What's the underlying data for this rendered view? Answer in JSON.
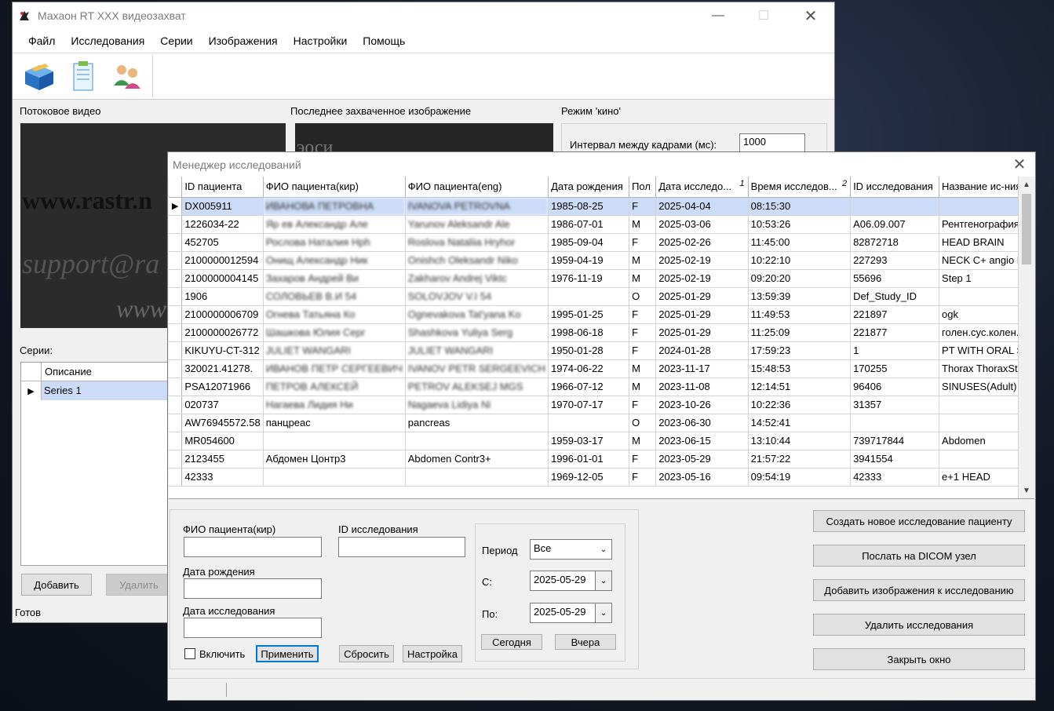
{
  "main_window": {
    "title": "Махаон RT XXX видеозахват",
    "menu": [
      "Файл",
      "Исследования",
      "Серии",
      "Изображения",
      "Настройки",
      "Помощь"
    ],
    "labels": {
      "stream_video": "Потоковое видео",
      "last_captured": "Последнее захваченное изображение",
      "cine_mode": "Режим 'кино'",
      "frame_interval": "Интервал между кадрами (мс):",
      "series": "Серии:"
    },
    "frame_interval_value": "1000",
    "video_watermark": [
      "www.rastr.n",
      "support@ra",
      "www"
    ],
    "last_image_text": "эоси",
    "series_table": {
      "header": "Описание",
      "rows": [
        "Series 1"
      ]
    },
    "buttons": {
      "add": "Добавить",
      "delete": "Удалить"
    },
    "status": "Готов"
  },
  "dialog": {
    "title": "Менеджер исследований",
    "columns": [
      "ID пациента",
      "ФИО пациента(кир)",
      "ФИО пациента(eng)",
      "Дата рождения",
      "Пол",
      "Дата исследо...",
      "Время исследов...",
      "ID исследования",
      "Название ис-ния"
    ],
    "sort_marks": {
      "date": "1",
      "time": "2"
    },
    "rows": [
      [
        "DX005911",
        "ИВАНОВА ПЕТРОВНА",
        "IVANOVA PETROVNA",
        "1985-08-25",
        "F",
        "2025-04-04",
        "08:15:30",
        "",
        ""
      ],
      [
        "1226034-22",
        "Яр  ев Александр Але",
        "Yarunov Aleksandr Ale",
        "1986-07-01",
        "M",
        "2025-03-06",
        "10:53:26",
        "A06.09.007",
        "Рентгенография л"
      ],
      [
        "452705",
        "Рослова Наталия Hph",
        "Roslova Nataliia Hryhor",
        "1985-09-04",
        "F",
        "2025-02-26",
        "11:45:00",
        "82872718",
        "HEAD BRAIN"
      ],
      [
        "2100000012594",
        "Онищ  Александр Ник",
        "Onishch Oleksandr Niko",
        "1959-04-19",
        "M",
        "2025-02-19",
        "10:22:10",
        "227293",
        "NECK C+ angio NE"
      ],
      [
        "2100000004145",
        "Захаров Андрей Ви",
        "Zakharov Andrej Viktc",
        "1976-11-19",
        "M",
        "2025-02-19",
        "09:20:20",
        "55696",
        "Step 1"
      ],
      [
        "1906",
        "СОЛОВЬЕВ В.И 54",
        "SOLOVJOV V.I 54",
        "",
        "O",
        "2025-01-29",
        "13:59:39",
        "Def_Study_ID",
        ""
      ],
      [
        "2100000006709",
        "Огнева Татьяна Ко",
        "Ognevakova Tat'yana Ko",
        "1995-01-25",
        "F",
        "2025-01-29",
        "11:49:53",
        "221897",
        "ogk"
      ],
      [
        "2100000026772",
        "Шашкова Юлия Серг",
        "Shashkova Yuliya Serg",
        "1998-06-18",
        "F",
        "2025-01-29",
        "11:25:09",
        "221877",
        "голен.сус.колен.с"
      ],
      [
        "KIKUYU-CT-312",
        "JULIET WANGARI",
        "JULIET WANGARI",
        "1950-01-28",
        "F",
        "2024-01-28",
        "17:59:23",
        "1",
        "PT WITH ORAL SC"
      ],
      [
        "320021.41278.",
        "ИВАНОВ ПЕТР СЕРГЕЕВИЧ",
        "IVANOV PETR SERGEEVICH",
        "1974-06-22",
        "M",
        "2023-11-17",
        "15:48:53",
        "170255",
        "Thorax ThoraxStar"
      ],
      [
        "PSA12071966",
        "ПЕТРОВ АЛЕКСЕЙ",
        "PETROV ALEKSEJ MGS",
        "1966-07-12",
        "M",
        "2023-11-08",
        "12:14:51",
        "96406",
        "SINUSES(Adult)"
      ],
      [
        "020737",
        "Нагаева Лидия Ни",
        "Nagaeva Lidiya Ni",
        "1970-07-17",
        "F",
        "2023-10-26",
        "10:22:36",
        "31357",
        ""
      ],
      [
        "AW76945572.58",
        "панцреас",
        "pancreas",
        "",
        "O",
        "2023-06-30",
        "14:52:41",
        "",
        ""
      ],
      [
        "MR054600",
        "",
        "",
        "1959-03-17",
        "M",
        "2023-06-15",
        "13:10:44",
        "739717844",
        "Abdomen"
      ],
      [
        "2123455",
        "Абдомен Цонтр3",
        "Abdomen Contr3+",
        "1996-01-01",
        "F",
        "2023-05-29",
        "21:57:22",
        "3941554",
        ""
      ],
      [
        "42333",
        "",
        "",
        "1969-12-05",
        "F",
        "2023-05-16",
        "09:54:19",
        "42333",
        "e+1  HEAD"
      ]
    ],
    "filter": {
      "fio_label": "ФИО пациента(кир)",
      "study_id_label": "ID исследования",
      "birth_label": "Дата рождения",
      "study_date_label": "Дата исследования",
      "include_label": "Включить",
      "apply": "Применить",
      "reset": "Сбросить",
      "settings": "Настройка",
      "period_label": "Период",
      "period_value": "Все",
      "from_label": "С:",
      "from_value": "2025-05-29",
      "to_label": "По:",
      "to_value": "2025-05-29",
      "today": "Сегодня",
      "yesterday": "Вчера"
    },
    "actions": {
      "create": "Создать новое исследование пациенту",
      "send_dicom": "Послать на DICOM узел",
      "add_images": "Добавить изображения к исследованию",
      "delete_studies": "Удалить исследования",
      "close": "Закрыть окно"
    }
  }
}
